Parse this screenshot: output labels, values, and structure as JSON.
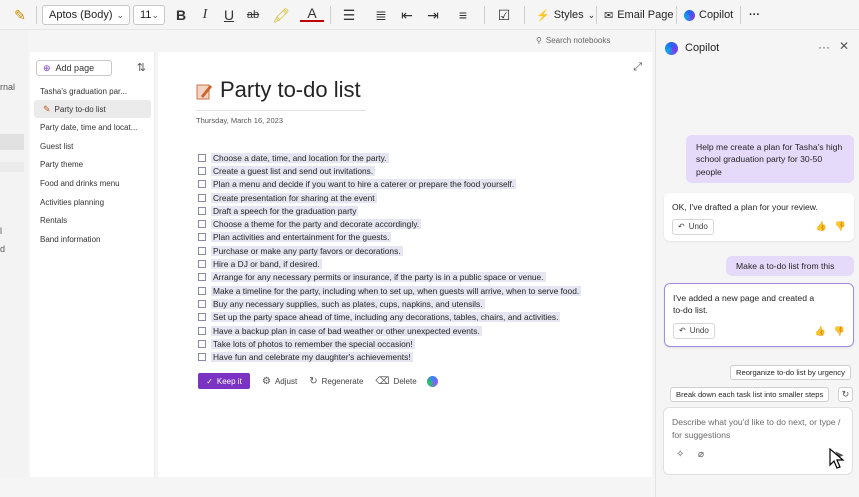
{
  "ribbon": {
    "font_name": "Aptos (Body)",
    "font_size": "11",
    "styles_label": "Styles",
    "email_page_label": "Email Page",
    "copilot_label": "Copilot",
    "more_label": "···"
  },
  "left_strip": {
    "fragment_1": "rnal",
    "fragment_2": "l",
    "fragment_3": "d"
  },
  "search": {
    "placeholder": "Search notebooks"
  },
  "page_list": {
    "add_page_label": "Add page",
    "items": [
      {
        "label": "Tasha's graduation par..."
      },
      {
        "label": "Party to-do list"
      },
      {
        "label": "Party date, time and locat..."
      },
      {
        "label": "Guest list"
      },
      {
        "label": "Party theme"
      },
      {
        "label": "Food and drinks menu"
      },
      {
        "label": "Activities planning"
      },
      {
        "label": "Rentals"
      },
      {
        "label": "Band information"
      }
    ]
  },
  "page": {
    "title": "Party to-do list",
    "date": "Thursday, March 16, 2023",
    "todos": [
      "Choose a date, time, and location for the party.",
      "Create a guest list and send out invitations.",
      "Plan a menu and decide if you want to hire a caterer or prepare the food yourself.",
      "Create presentation for sharing at the event",
      "Draft a speech for the graduation party",
      "Choose a theme for the party and decorate accordingly.",
      "Plan activities and entertainment for the guests.",
      "Purchase or make any party favors or decorations.",
      "Hire a DJ or band, if desired.",
      "Arrange for any necessary permits or insurance, if the party is in a public space or venue.",
      "Make a timeline for the party, including when to set up, when guests will arrive, when to serve food.",
      "Buy any necessary supplies, such as plates, cups, napkins, and utensils.",
      "Set up the party space ahead of time, including any decorations, tables, chairs, and activities.",
      "Have a backup plan in case of bad weather or other unexpected events.",
      "Take lots of photos to remember the special occasion!",
      "Have fun and celebrate my daughter's achievements!"
    ],
    "actions": {
      "keep": "Keep it",
      "adjust": "Adjust",
      "regenerate": "Regenerate",
      "delete": "Delete"
    }
  },
  "copilot": {
    "title": "Copilot",
    "user_msg_1": "Help me create a plan for Tasha's high school graduation party for 30-50 people",
    "bot_msg_1": "OK, I've drafted a plan for your review.",
    "user_msg_2": "Make a to-do list from this",
    "bot_msg_2": "I've added a new page and created a to-do list.",
    "undo_label": "Undo",
    "suggestion_1": "Reorganize to-do list by urgency",
    "suggestion_2": "Break down each task list into smaller steps",
    "composer_placeholder": "Describe what you'd like to do next, or type / for suggestions"
  },
  "colors": {
    "accent_purple": "#7a33c2",
    "user_bubble": "#e6dafb",
    "todo_highlight": "#e6e6f2"
  }
}
